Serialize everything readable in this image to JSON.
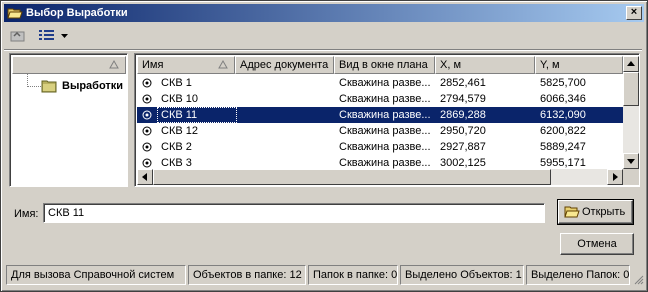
{
  "window": {
    "title": "Выбор Выработки",
    "close_label": "×"
  },
  "toolbar": {
    "items": [
      "up-folder-icon",
      "view-list-icon",
      "dropdown-arrow-icon"
    ]
  },
  "tree": {
    "root_label": "Выработки"
  },
  "table": {
    "columns": [
      "Имя",
      "Адрес документа",
      "Вид в окне плана",
      "X, м",
      "Y, м"
    ],
    "rows": [
      {
        "name": "СКВ 1",
        "address": "",
        "view": "Скважина разве...",
        "x": "2852,461",
        "y": "5825,700",
        "selected": false
      },
      {
        "name": "СКВ 10",
        "address": "",
        "view": "Скважина разве...",
        "x": "2794,579",
        "y": "6066,346",
        "selected": false
      },
      {
        "name": "СКВ 11",
        "address": "",
        "view": "Скважина разве...",
        "x": "2869,288",
        "y": "6132,090",
        "selected": true
      },
      {
        "name": "СКВ 12",
        "address": "",
        "view": "Скважина разве...",
        "x": "2950,720",
        "y": "6200,822",
        "selected": false
      },
      {
        "name": "СКВ 2",
        "address": "",
        "view": "Скважина разве...",
        "x": "2927,887",
        "y": "5889,247",
        "selected": false
      },
      {
        "name": "СКВ 3",
        "address": "",
        "view": "Скважина разве...",
        "x": "3002,125",
        "y": "5955,171",
        "selected": false
      }
    ]
  },
  "form": {
    "name_label": "Имя:",
    "name_value": "СКВ 11",
    "open_label": "Открыть",
    "cancel_label": "Отмена"
  },
  "status": {
    "help": "Для вызова Справочной систем",
    "objects_in_folder": "Объектов в папке: 12",
    "folders_in_folder": "Папок в папке: 0",
    "selected_objects": "Выделено Объектов: 1",
    "selected_folders": "Выделено Папок: 0"
  },
  "colors": {
    "title_bar": "#0a246a",
    "selection": "#0a246a",
    "face": "#d4d0c8"
  }
}
